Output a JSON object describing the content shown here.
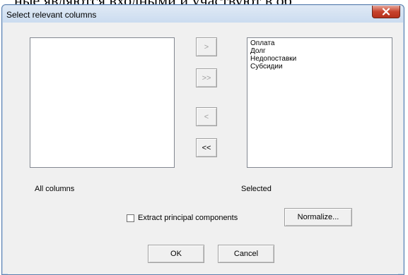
{
  "background_text": "ные являются входными и участвуют в об",
  "window": {
    "title": "Select relevant columns",
    "close_label": "x"
  },
  "available_list": {
    "label": "All columns",
    "items": []
  },
  "selected_list": {
    "label": "Selected",
    "items": [
      "Оплата",
      "Долг",
      "Недопоставки",
      "Субсидии"
    ]
  },
  "transfer_buttons": {
    "add_label": ">",
    "add_all_label": ">>",
    "remove_label": "<",
    "remove_all_label": "<<"
  },
  "options": {
    "extract_pc_label": "Extract principal components",
    "extract_pc_checked": false,
    "normalize_label": "Normalize..."
  },
  "footer": {
    "ok_label": "OK",
    "cancel_label": "Cancel"
  },
  "colors": {
    "titlebar": "#cbdcf0",
    "close_button": "#c7432d",
    "dialog_background": "#f0f0f0"
  }
}
